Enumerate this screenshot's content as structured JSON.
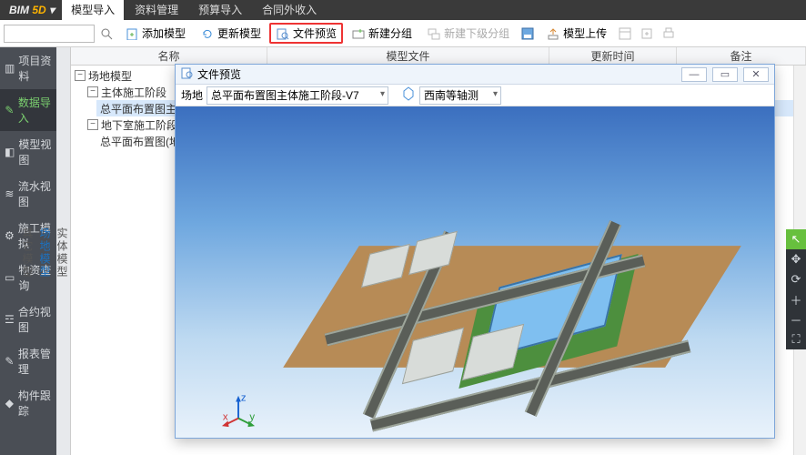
{
  "app": {
    "name_a": "BIM",
    "name_b": " 5D",
    "dropdown_glyph": "▾"
  },
  "menu_tabs": [
    "模型导入",
    "资料管理",
    "预算导入",
    "合同外收入"
  ],
  "toolbar": {
    "search_placeholder": "",
    "add_model": "添加模型",
    "update_model": "更新模型",
    "file_preview": "文件预览",
    "new_group": "新建分组",
    "new_subgroup": "新建下级分组",
    "model_upload": "模型上传"
  },
  "columns": {
    "name": "名称",
    "model_file": "模型文件",
    "update_time": "更新时间",
    "remark": "备注"
  },
  "tree": {
    "n1": "场地模型",
    "n2": "主体施工阶段",
    "n3": "总平面布置图主体施工阶段",
    "n4": "地下室施工阶段",
    "n5": "总平面布置图(地下室施工…)"
  },
  "vbars": {
    "a1": "实体模型",
    "a2": "场地模型",
    "a3": "其它模型"
  },
  "sidebar": {
    "items": [
      {
        "label": "项目资料"
      },
      {
        "label": "数据导入"
      },
      {
        "label": "模型视图"
      },
      {
        "label": "流水视图"
      },
      {
        "label": "施工模拟"
      },
      {
        "label": "物资查询"
      },
      {
        "label": "合约视图"
      },
      {
        "label": "报表管理"
      },
      {
        "label": "构件跟踪"
      }
    ]
  },
  "dialog": {
    "title": "文件预览",
    "field_label": "场地",
    "field_value": "总平面布置图主体施工阶段-V7",
    "orientation": "西南等轴测"
  },
  "axes": {
    "x": "x",
    "y": "y",
    "z": "z"
  }
}
